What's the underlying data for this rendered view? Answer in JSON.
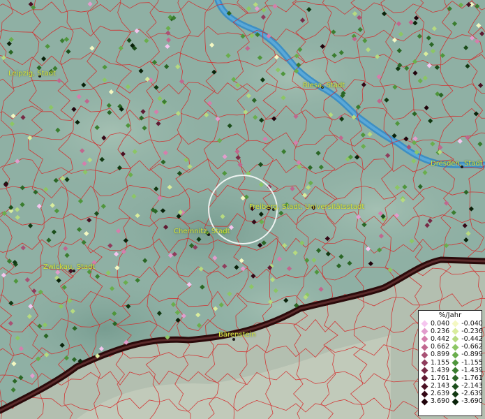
{
  "map": {
    "cities": [
      {
        "name": "Leipzig, Stadt"
      },
      {
        "name": "Riesa, Stadt"
      },
      {
        "name": "Dresden, Stadt"
      },
      {
        "name": "Freiberg, Stadt, Universitätsstadt"
      },
      {
        "name": "Chemnitz, Stadt"
      },
      {
        "name": "Zwickau, Stadt"
      },
      {
        "name": "Bärenstein"
      }
    ],
    "colors": {
      "terrain": "#8fb0a4",
      "river": "#3d8fc4",
      "border": "#d42a2a",
      "label": "#d8e23a"
    }
  },
  "legend": {
    "title": "%/Jahr",
    "positive": [
      {
        "value": "0.040",
        "color": "#f5c6ef"
      },
      {
        "value": "0.236",
        "color": "#e29ccd"
      },
      {
        "value": "0.442",
        "color": "#d57eac"
      },
      {
        "value": "0.662",
        "color": "#c0678e"
      },
      {
        "value": "0.899",
        "color": "#a95275"
      },
      {
        "value": "1.155",
        "color": "#8f3c5c"
      },
      {
        "value": "1.439",
        "color": "#772a46"
      },
      {
        "value": "1.761",
        "color": "#601b33"
      },
      {
        "value": "2.143",
        "color": "#4a1022"
      },
      {
        "value": "2.639",
        "color": "#350816"
      },
      {
        "value": "3.690",
        "color": "#20030b"
      }
    ],
    "negative": [
      {
        "value": "-0.040",
        "color": "#f4f8c2"
      },
      {
        "value": "-0.236",
        "color": "#d9ec9d"
      },
      {
        "value": "-0.442",
        "color": "#b6da80"
      },
      {
        "value": "-0.662",
        "color": "#8cc664"
      },
      {
        "value": "-0.899",
        "color": "#6aae4d"
      },
      {
        "value": "-1.155",
        "color": "#4f963c"
      },
      {
        "value": "-1.439",
        "color": "#3a7d2f"
      },
      {
        "value": "-1.761",
        "color": "#2a6625"
      },
      {
        "value": "-2.143",
        "color": "#1c4e1b"
      },
      {
        "value": "-2.639",
        "color": "#123912"
      },
      {
        "value": "-3.690",
        "color": "#0a220a"
      }
    ]
  }
}
